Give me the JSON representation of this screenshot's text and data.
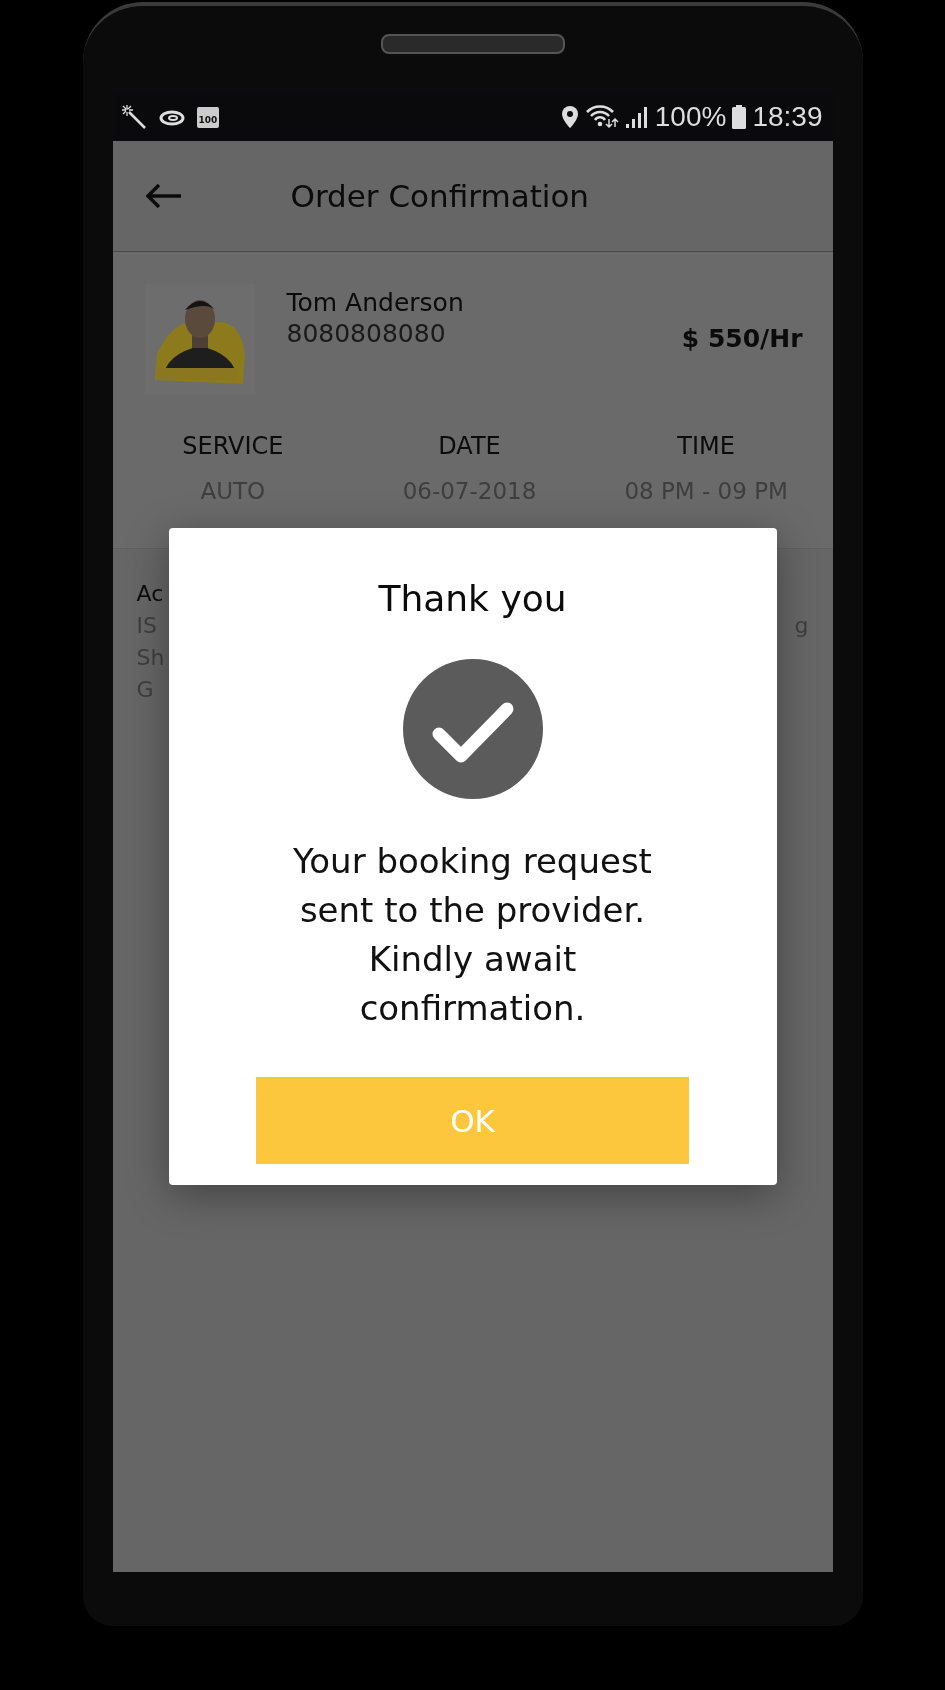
{
  "status_bar": {
    "battery_badge": "100",
    "battery_percent": "100%",
    "time": "18:39"
  },
  "header": {
    "title": "Order Confirmation"
  },
  "provider": {
    "name": "Tom Anderson",
    "phone": "8080808080",
    "rate": "$ 550/Hr"
  },
  "details": [
    {
      "label": "SERVICE",
      "value": "AUTO"
    },
    {
      "label": "DATE",
      "value": "06-07-2018"
    },
    {
      "label": "TIME",
      "value": "08 PM - 09 PM"
    }
  ],
  "address": {
    "label": "Ac",
    "line_starts": [
      "IS",
      "Sh",
      "G"
    ],
    "line_ends": [
      "g"
    ]
  },
  "dialog": {
    "title": "Thank you",
    "message": "Your booking request sent to the provider. Kindly await confirmation.",
    "button": "OK"
  }
}
